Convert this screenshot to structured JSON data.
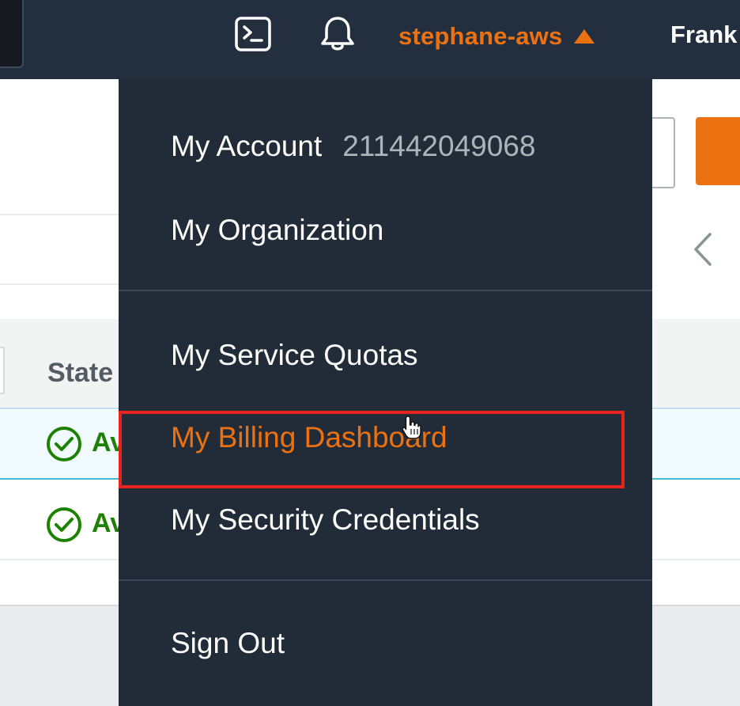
{
  "topbar": {
    "icons": [
      "cloudshell-icon",
      "bell-icon"
    ],
    "account_menu_label": "stephane-aws",
    "region_label": "Frank"
  },
  "background": {
    "state_column_header": "State",
    "rows": [
      {
        "status_icon": "check-circle-icon",
        "status_text": "Av"
      },
      {
        "status_icon": "check-circle-icon",
        "status_text": "Av"
      }
    ]
  },
  "dropdown": {
    "my_account_label": "My Account",
    "account_id": "211442049068",
    "my_organization_label": "My Organization",
    "my_service_quotas_label": "My Service Quotas",
    "my_billing_dashboard_label": "My Billing Dashboard",
    "my_security_credentials_label": "My Security Credentials",
    "sign_out_label": "Sign Out"
  },
  "colors": {
    "nav_background": "#232f3e",
    "dropdown_background": "#222b38",
    "accent": "#ec7211",
    "highlight_border": "#e8231b",
    "success": "#1d8102",
    "muted_text": "#aab7b8"
  }
}
